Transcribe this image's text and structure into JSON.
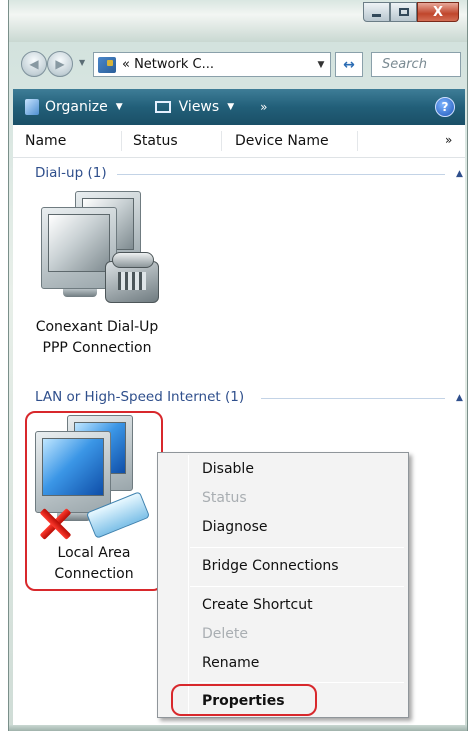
{
  "window": {
    "title_buttons": {
      "minimize": "–",
      "maximize": "□",
      "close": "X"
    }
  },
  "address_bar": {
    "path": "« Network C...",
    "search_placeholder": "Search"
  },
  "toolbar": {
    "organize_label": "Organize",
    "views_label": "Views",
    "more_label": "»",
    "help_label": "?"
  },
  "columns": {
    "name": "Name",
    "status": "Status",
    "device_name": "Device Name",
    "more": "»"
  },
  "groups": [
    {
      "header": "Dial-up (1)",
      "items": [
        {
          "label_line1": "Conexant Dial-Up",
          "label_line2": "PPP Connection",
          "icon": "dialup-connection-icon"
        }
      ]
    },
    {
      "header": "LAN or High-Speed Internet (1)",
      "items": [
        {
          "label_line1": "Local Area",
          "label_line2": "Connection",
          "icon": "lan-connection-disabled-icon",
          "selected": true
        }
      ]
    }
  ],
  "context_menu": {
    "items": [
      {
        "label": "Disable",
        "enabled": true
      },
      {
        "label": "Status",
        "enabled": false
      },
      {
        "label": "Diagnose",
        "enabled": true
      },
      {
        "label": "Bridge Connections",
        "enabled": true
      },
      {
        "label": "Create Shortcut",
        "enabled": true
      },
      {
        "label": "Delete",
        "enabled": false
      },
      {
        "label": "Rename",
        "enabled": true
      },
      {
        "label": "Properties",
        "enabled": true,
        "default": true
      }
    ]
  },
  "colors": {
    "toolbar": "#225f79",
    "group_header": "#2f4f8c",
    "highlight_outline": "#d8282c"
  }
}
